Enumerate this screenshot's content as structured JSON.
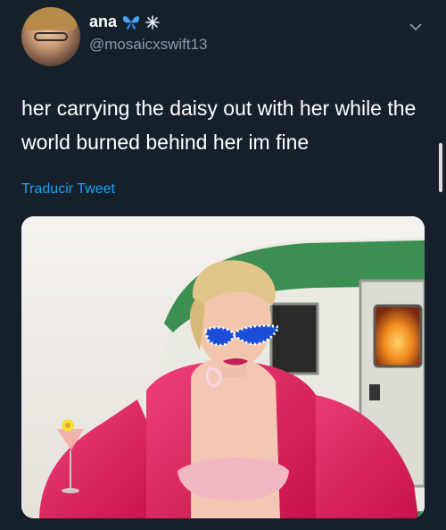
{
  "user": {
    "name": "ana",
    "handle": "@mosaicxswift13"
  },
  "tweet": {
    "text": "her carrying the daisy out with her while the world burned behind her im fine",
    "translate_link": "Traducir Tweet"
  },
  "icons": {
    "verified_emoji": "butterfly-icon",
    "badge_emoji": "sparkle-icon",
    "menu": "chevron-down-icon"
  },
  "colors": {
    "background": "#15202b",
    "handle": "#8899a6",
    "link": "#1da1f2",
    "coat": "#e8205d",
    "trailer_green": "#3c8e52"
  }
}
